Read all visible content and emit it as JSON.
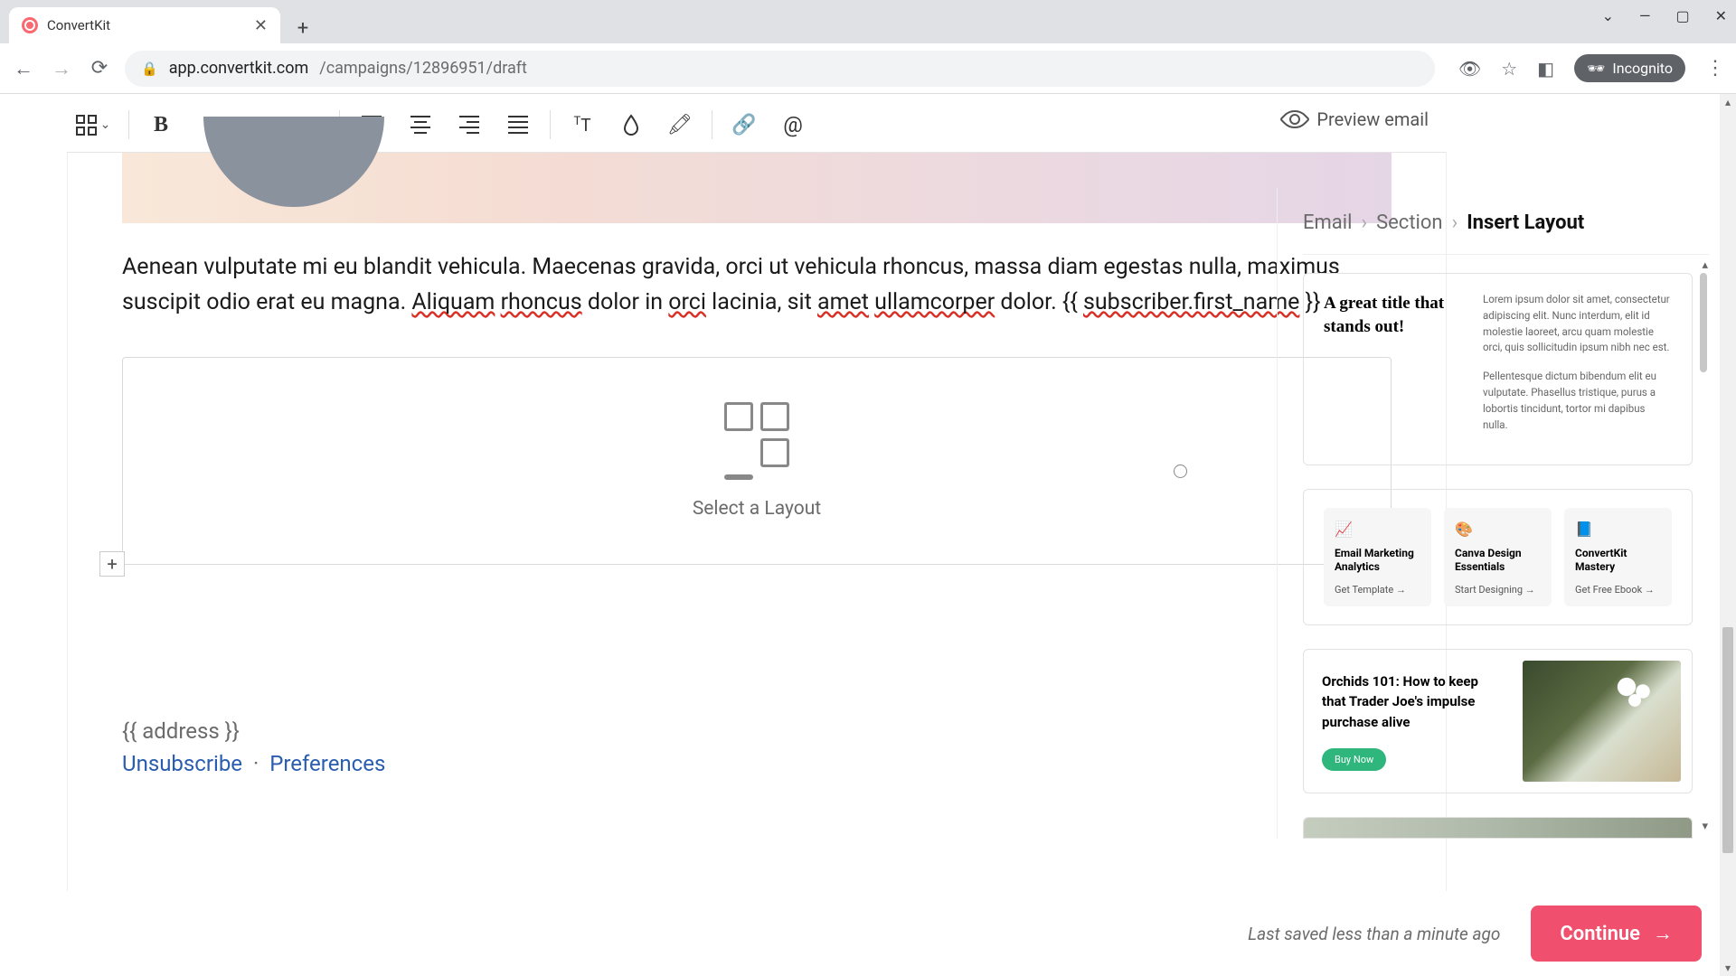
{
  "browser": {
    "tab_title": "ConvertKit",
    "url_host": "app.convertkit.com",
    "url_path": "/campaigns/12896951/draft",
    "incognito_label": "Incognito"
  },
  "toolbar": {
    "preview_label": "Preview email"
  },
  "editor": {
    "body_text_parts": {
      "p1": "Aenean vulputate mi eu blandit vehicula. Maecenas gravida, orci ut vehicula rhoncus, massa diam egestas nulla, maximus suscipit odio erat eu magna. ",
      "w_aliquam": "Aliquam",
      "sp1": " ",
      "w_rhoncus": "rhoncus",
      "p2": " dolor in ",
      "w_orci": "orci",
      "p3": " lacinia, sit ",
      "w_amet": "amet",
      "sp2": " ",
      "w_ullamcorper": "ullamcorper",
      "p4": " dolor. ",
      "tag_open": "{{ ",
      "w_sub": "subscriber.first_name",
      "tag_close": " }}"
    },
    "layout_placeholder": "Select a Layout",
    "address_tag": "{{ address }}",
    "unsubscribe": "Unsubscribe",
    "preferences": "Preferences"
  },
  "sidebar": {
    "crumb_email": "Email",
    "crumb_section": "Section",
    "crumb_current": "Insert Layout",
    "card1": {
      "title": "A great title that stands out!",
      "para1": "Lorem ipsum dolor sit amet, consectetur adipiscing elit. Nunc interdum, elit id molestie laoreet, arcu quam molestie orci, quis sollicitudin ipsum nibh nec est.",
      "para2": "Pellentesque dictum bibendum elit eu vulputate. Phasellus tristique, purus a lobortis tincidunt, tortor mi dapibus nulla."
    },
    "card2": {
      "items": [
        {
          "emoji": "📈",
          "title": "Email Marketing Analytics",
          "link": "Get Template →"
        },
        {
          "emoji": "🎨",
          "title": "Canva Design Essentials",
          "link": "Start Designing →"
        },
        {
          "emoji": "📘",
          "title": "ConvertKit Mastery",
          "link": "Get Free Ebook →"
        }
      ]
    },
    "card3": {
      "heading": "Orchids 101:  How to keep that Trader Joe's impulse purchase alive",
      "cta": "Buy Now"
    }
  },
  "footer": {
    "saved": "Last saved less than a minute ago",
    "continue": "Continue"
  }
}
